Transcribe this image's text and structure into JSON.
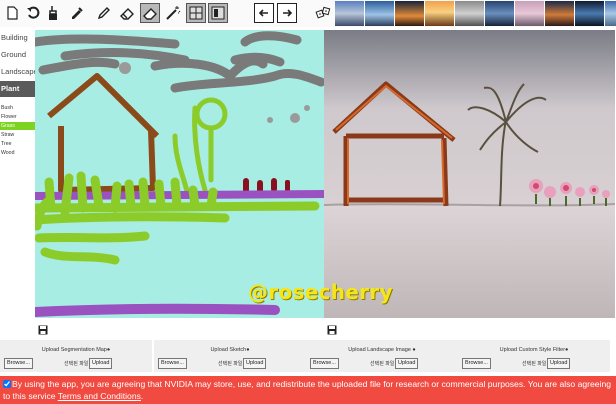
{
  "toolbar": {
    "tools": [
      {
        "icon": "new-page-icon"
      },
      {
        "icon": "undo-icon"
      },
      {
        "icon": "paint-bucket-icon"
      },
      {
        "icon": "paint-dropper-icon"
      },
      {
        "icon": "pencil-icon"
      },
      {
        "icon": "eraser-icon"
      },
      {
        "icon": "eraser-tool-icon"
      },
      {
        "icon": "magic-wand-icon"
      },
      {
        "icon": "layout-split-icon"
      },
      {
        "icon": "layout-toggle-icon"
      },
      {
        "icon": "arrow-left-icon"
      },
      {
        "icon": "arrow-right-icon"
      },
      {
        "icon": "dice-icon"
      }
    ],
    "style_thumbnails_count": 10
  },
  "sidebar": {
    "categories": [
      "Building",
      "Ground",
      "Landscape",
      "Plant"
    ],
    "active_category": "Plant",
    "subitems": [
      "Bush",
      "Flower",
      "Grass",
      "Straw",
      "Tree",
      "Wood"
    ],
    "active_subitem": "Grass"
  },
  "watermark": "@rosecherry",
  "uploads": [
    {
      "title": "Upload Segmentation Map●",
      "browse": "Browse...",
      "nofile": "선택된 파일 없음",
      "upload": "Upload"
    },
    {
      "title": "Upload Sketch●",
      "browse": "Browse...",
      "nofile": "선택된 파일 없음",
      "upload": "Upload"
    },
    {
      "title": "Upload Landscape Image ●",
      "browse": "Browse...",
      "nofile": "선택된 파일 없음",
      "upload": "Upload"
    },
    {
      "title": "Upload Custom Style Filter●",
      "browse": "Browse...",
      "nofile": "선택된 파일 없음",
      "upload": "Upload"
    }
  ],
  "consent": {
    "text": "By using the app, you are agreeing that NVIDIA may store, use, and redistribute the uploaded file for research or commercial purposes. You are also agreeing to this service ",
    "link": "Terms and Conditions",
    "end": "."
  }
}
